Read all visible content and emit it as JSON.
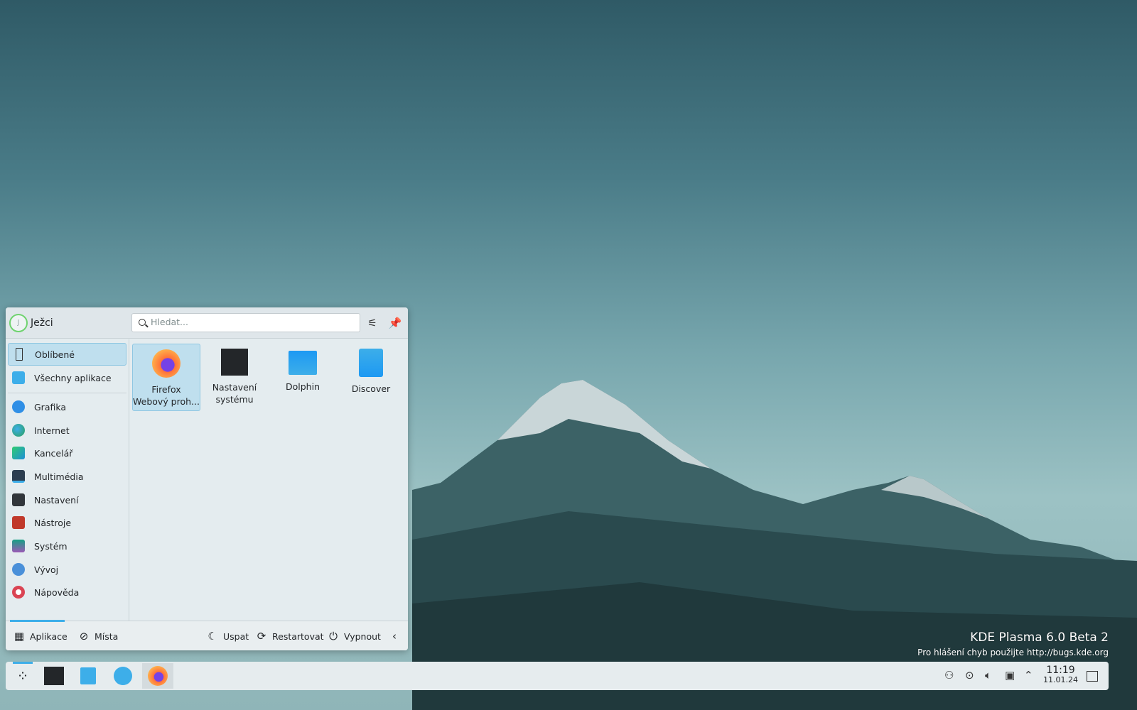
{
  "user": {
    "name": "Ježci",
    "initial": "J"
  },
  "search": {
    "placeholder": "Hledat..."
  },
  "sidebar": {
    "items": [
      {
        "label": "Oblíbené",
        "icon": "bookmark-icon",
        "color": "#ffffff"
      },
      {
        "label": "Všechny aplikace",
        "icon": "grid-apps-icon",
        "color": "#3daee9"
      },
      {
        "label": "Grafika",
        "icon": "graphics-icon",
        "color": "#2f8fe6"
      },
      {
        "label": "Internet",
        "icon": "globe-icon",
        "color": "#2aa05a"
      },
      {
        "label": "Kancelář",
        "icon": "office-icon",
        "color": "#1f8fd6"
      },
      {
        "label": "Multimédia",
        "icon": "multimedia-icon",
        "color": "#2c3e50"
      },
      {
        "label": "Nastavení",
        "icon": "settings-icon",
        "color": "#31363b"
      },
      {
        "label": "Nástroje",
        "icon": "toolbox-icon",
        "color": "#c0392b"
      },
      {
        "label": "Systém",
        "icon": "system-icon",
        "color": "#16a085"
      },
      {
        "label": "Vývoj",
        "icon": "development-icon",
        "color": "#4a90d9"
      },
      {
        "label": "Nápověda",
        "icon": "help-icon",
        "color": "#da4453"
      }
    ]
  },
  "favorites": [
    {
      "line1": "Firefox",
      "line2": "Webový proh...",
      "icon": "firefox-icon"
    },
    {
      "line1": "Nastavení",
      "line2": "systému",
      "icon": "system-settings-icon"
    },
    {
      "line1": "Dolphin",
      "line2": "",
      "icon": "dolphin-folder-icon"
    },
    {
      "line1": "Discover",
      "line2": "",
      "icon": "discover-icon"
    }
  ],
  "footer": {
    "apps": "Aplikace",
    "places": "Místa",
    "sleep": "Uspat",
    "restart": "Restartovat",
    "shutdown": "Vypnout"
  },
  "clock": {
    "time": "11:19",
    "date": "11.01.24"
  },
  "watermark": {
    "title": "KDE Plasma 6.0 Beta 2",
    "subtitle": "Pro hlášení chyb použijte http://bugs.kde.org"
  }
}
